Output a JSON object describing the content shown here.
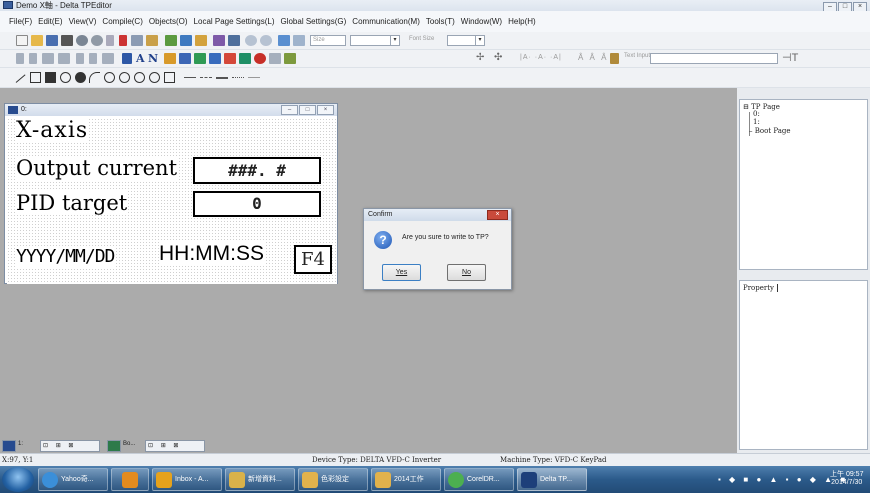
{
  "window": {
    "title": "Demo X軸 - Delta TPEditor",
    "buttons": [
      "–",
      "□",
      "×"
    ]
  },
  "menu": [
    "File(F)",
    "Edit(E)",
    "View(V)",
    "Compile(C)",
    "Objects(O)",
    "Local Page Settings(L)",
    "Global Settings(G)",
    "Communication(M)",
    "Tools(T)",
    "Window(W)",
    "Help(H)"
  ],
  "toolbar": {
    "size_placeholder": "Size",
    "fontsize_placeholder": "Font Size",
    "text_input_placeholder": "Text Input"
  },
  "editor_window": {
    "title": "0:",
    "buttons": [
      "–",
      "□",
      "×"
    ],
    "screen": {
      "header": "X-axis",
      "row1_label": "Output current",
      "row1_value": "###. #",
      "row2_label": "PID target",
      "row2_value": "0",
      "datetime_date": "YYYY/MM/DD",
      "datetime_time": "HH:MM:SS",
      "fkey": "F4"
    }
  },
  "tree": {
    "root": "TP Page",
    "children": [
      "0:",
      "1:"
    ],
    "boot": "Boot Page"
  },
  "property_tab": "Property",
  "dialog": {
    "title": "Confirm",
    "close": "×",
    "message": "Are you sure to write to TP?",
    "yes": "Yes",
    "no": "No"
  },
  "bottom_tabs": [
    "1:",
    "Bo..."
  ],
  "status": {
    "coords": "X:97, Y:1",
    "device": "Device Type: DELTA VFD-C Inverter",
    "machine": "Machine Type: VFD-C KeyPad"
  },
  "taskbar": {
    "items": [
      "Yahoo奇...",
      "",
      "Inbox - A...",
      "新增資料...",
      "色彩設定",
      "2014工作",
      "CorelDR...",
      "Delta TP..."
    ],
    "clock_time": "上午 09:57",
    "clock_date": "2014/7/30"
  },
  "colors": {
    "accent": "#3a5f9e",
    "taskbar": "#2b5a8a",
    "dialog_close": "#c94a3b"
  }
}
